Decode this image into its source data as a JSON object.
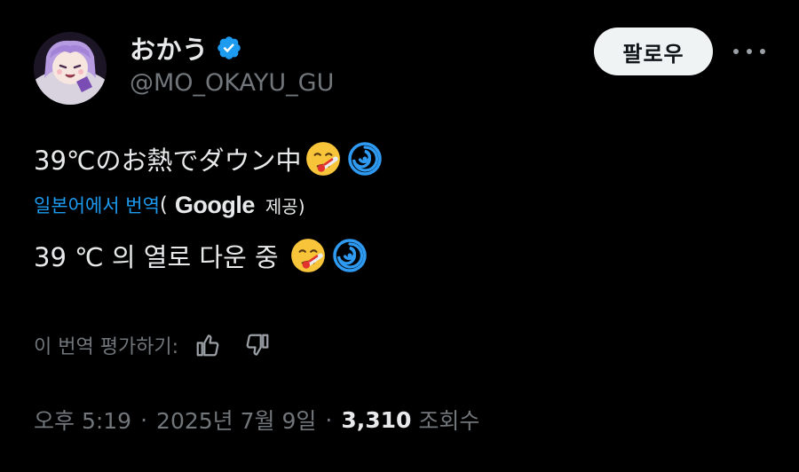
{
  "header": {
    "display_name": "おかう",
    "handle": "@MO_OKAYU_GU",
    "follow_label": "팔로우",
    "verified_icon": "verified-badge-icon",
    "more_icon": "more-options-icon",
    "accent_color": "#1d9bf0"
  },
  "tweet": {
    "original_text": "39℃のお熱でダウン中",
    "translate_link": "일본어에서 번역",
    "paren_open": "(",
    "google_logo": "Google",
    "provided_text": "제공)",
    "translated_text": "39 ℃ 의 열로 다운 중",
    "emojis": [
      "face-with-thermometer-icon",
      "dizzy-cyclone-icon"
    ]
  },
  "rating": {
    "label": "이 번역 평가하기:",
    "thumbs_up_icon": "thumbs-up-icon",
    "thumbs_down_icon": "thumbs-down-icon"
  },
  "meta": {
    "time": "오후 5:19",
    "separator1": "·",
    "date": "2025년 7월 9일",
    "separator2": "·",
    "views_count": "3,310",
    "views_label": "조회수"
  }
}
